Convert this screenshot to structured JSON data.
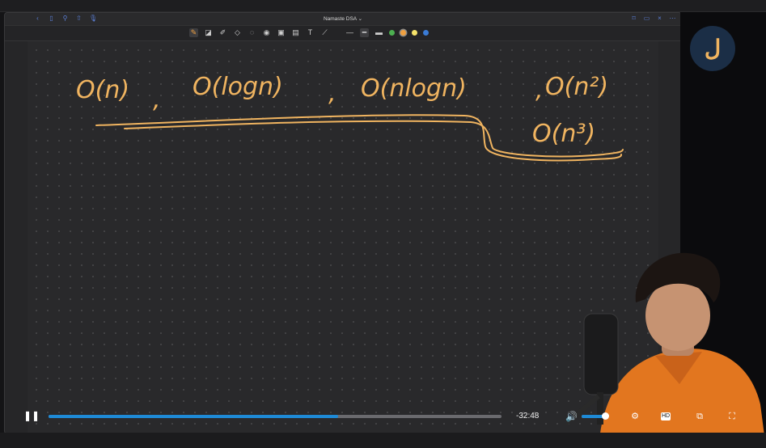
{
  "window": {
    "title": "Namaste DSA",
    "title_chevron": "⌄"
  },
  "titlebar_left": [
    {
      "name": "back-icon",
      "glyph": "‹"
    },
    {
      "name": "sidebar-icon",
      "glyph": "▯"
    },
    {
      "name": "search-icon",
      "glyph": "⚲"
    },
    {
      "name": "share-icon",
      "glyph": "⇧"
    },
    {
      "name": "mic-icon",
      "glyph": "🎙"
    }
  ],
  "titlebar_right": [
    {
      "name": "bookmark-icon",
      "glyph": "⌑"
    },
    {
      "name": "document-icon",
      "glyph": "▭"
    },
    {
      "name": "close-icon",
      "glyph": "×"
    },
    {
      "name": "more-icon",
      "glyph": "⋯"
    }
  ],
  "toolbar_tools": [
    {
      "name": "pen-tool-icon",
      "glyph": "✎",
      "active": true
    },
    {
      "name": "eraser-tool-icon",
      "glyph": "◪"
    },
    {
      "name": "highlighter-tool-icon",
      "glyph": "✐"
    },
    {
      "name": "shapes-tool-icon",
      "glyph": "◇"
    },
    {
      "name": "lasso-tool-icon",
      "glyph": "◌"
    },
    {
      "name": "camera-tool-icon",
      "glyph": "◉"
    },
    {
      "name": "image-tool-icon",
      "glyph": "▣"
    },
    {
      "name": "sticker-tool-icon",
      "glyph": "▤"
    },
    {
      "name": "text-tool-icon",
      "glyph": "T"
    },
    {
      "name": "eyedropper-tool-icon",
      "glyph": "⟋"
    }
  ],
  "toolbar_strokes": [
    {
      "name": "stroke-thin-icon",
      "glyph": "—"
    },
    {
      "name": "stroke-medium-icon",
      "glyph": "━",
      "active": true
    },
    {
      "name": "stroke-thick-icon",
      "glyph": "▬"
    }
  ],
  "toolbar_colors": [
    "#4caf50",
    "#f0a040",
    "#f5e26a",
    "#3a7bd5"
  ],
  "ink_strokes": {
    "color": "#f0b460",
    "expressions": [
      "O(n)",
      "O(logn)",
      "O(nlogn)",
      "O(n²)",
      "O(n³)"
    ],
    "separators": [
      ",",
      ",",
      ","
    ]
  },
  "logo": {
    "glyph": "ل"
  },
  "player": {
    "time_remaining": "-32:48",
    "progress": 0.64,
    "volume": 0.95,
    "accent": "#1e8ad6",
    "icons": {
      "play": "❚❚",
      "volume": "🔊",
      "settings": "⚙",
      "hd": "HD",
      "pip": "⧉",
      "fullscreen": "⛶"
    }
  }
}
